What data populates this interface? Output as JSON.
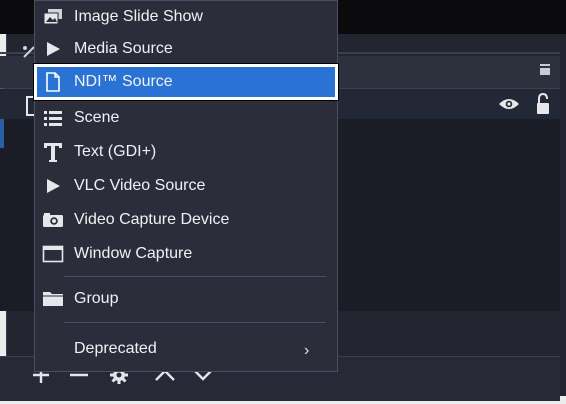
{
  "menu": {
    "items": [
      {
        "label": "Image Slide Show",
        "icon": "slideshow-icon"
      },
      {
        "label": "Media Source",
        "icon": "play-icon"
      },
      {
        "label": "NDI™ Source",
        "icon": "file-icon",
        "selected": true
      },
      {
        "label": "Scene",
        "icon": "list-icon"
      },
      {
        "label": "Text (GDI+)",
        "icon": "text-icon"
      },
      {
        "label": "VLC Video Source",
        "icon": "play-icon"
      },
      {
        "label": "Video Capture Device",
        "icon": "camera-icon"
      },
      {
        "label": "Window Capture",
        "icon": "window-icon"
      },
      {
        "label": "Group",
        "icon": "folder-icon"
      },
      {
        "label": "Deprecated",
        "icon": null,
        "submenu": true
      }
    ],
    "submenu_glyph": "›"
  },
  "colors": {
    "selection": "#2a73d4",
    "menu_bg": "#2b2e3a",
    "dock_bg": "#1b1d26"
  },
  "toolbar": {
    "buttons": [
      "add-icon",
      "remove-icon",
      "gear-icon",
      "move-up-icon",
      "move-down-icon"
    ]
  }
}
